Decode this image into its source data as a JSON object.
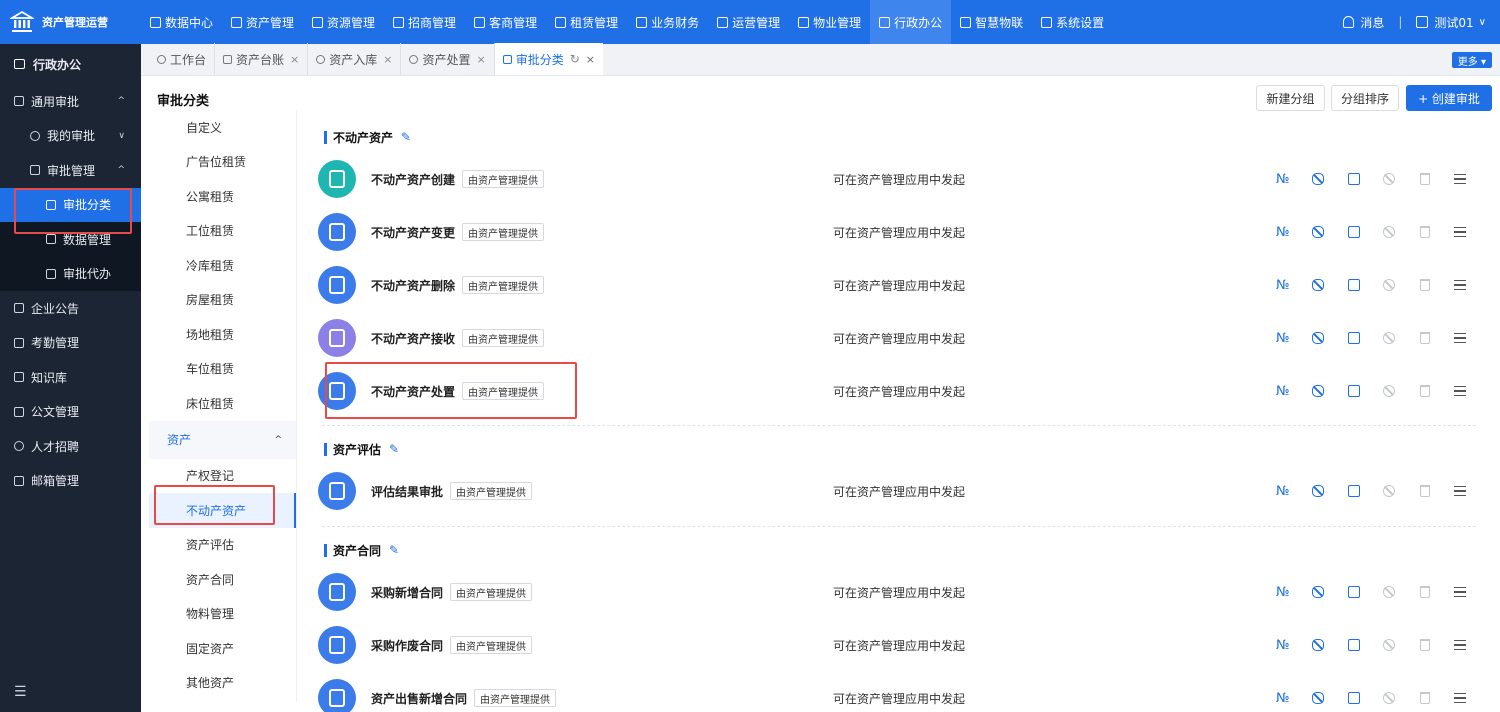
{
  "app": {
    "title": "资产管理运营"
  },
  "topnav": [
    {
      "label": "数据中心",
      "icon": "dashboard-icon"
    },
    {
      "label": "资产管理",
      "icon": "cube-icon"
    },
    {
      "label": "资源管理",
      "icon": "building-icon"
    },
    {
      "label": "招商管理",
      "icon": "tag-icon"
    },
    {
      "label": "客商管理",
      "icon": "users-icon"
    },
    {
      "label": "租赁管理",
      "icon": "home-icon"
    },
    {
      "label": "业务财务",
      "icon": "currency-icon"
    },
    {
      "label": "运营管理",
      "icon": "chart-icon"
    },
    {
      "label": "物业管理",
      "icon": "tools-icon"
    },
    {
      "label": "行政办公",
      "icon": "monitor-icon",
      "active": true
    },
    {
      "label": "智慧物联",
      "icon": "atom-icon"
    },
    {
      "label": "系统设置",
      "icon": "gear-icon"
    }
  ],
  "topright": {
    "messages": "消息",
    "separator": "|",
    "user": "测试01",
    "caret": "∨"
  },
  "sidebar": {
    "header": "行政办公",
    "items": [
      {
        "label": "通用审批",
        "arrow": "^"
      },
      {
        "label": "我的审批",
        "arrow": "∨"
      },
      {
        "label": "审批管理",
        "arrow": "^"
      },
      {
        "label": "审批分类"
      },
      {
        "label": "数据管理"
      },
      {
        "label": "审批代办"
      },
      {
        "label": "企业公告"
      },
      {
        "label": "考勤管理"
      },
      {
        "label": "知识库"
      },
      {
        "label": "公文管理"
      },
      {
        "label": "人才招聘"
      },
      {
        "label": "邮箱管理"
      }
    ],
    "collapse": "☰"
  },
  "tabs": [
    {
      "label": "工作台"
    },
    {
      "label": "资产台账",
      "close": "×"
    },
    {
      "label": "资产入库",
      "close": "×"
    },
    {
      "label": "资产处置",
      "close": "×"
    },
    {
      "label": "审批分类",
      "close": "×",
      "reload": "↻"
    }
  ],
  "more_button": "更多 ▾",
  "page": {
    "title": "审批分类",
    "buttons": {
      "new_group": "新建分组",
      "group_sort": "分组排序",
      "create": "+ 创建审批"
    }
  },
  "categories": {
    "items_top": [
      "自定义",
      "广告位租赁",
      "公寓租赁",
      "工位租赁",
      "冷库租赁",
      "房屋租赁",
      "场地租赁",
      "车位租赁",
      "床位租赁"
    ],
    "group": {
      "label": "资产",
      "arrow": "^"
    },
    "items_group": [
      "产权登记",
      "不动产资产",
      "资产评估",
      "资产合同",
      "物料管理",
      "固定资产",
      "其他资产"
    ]
  },
  "sections": [
    {
      "title": "不动产资产",
      "rows": [
        {
          "name": "不动产资产创建",
          "badge": "由资产管理提供",
          "desc": "可在资产管理应用中发起",
          "color": "#1fb5b0"
        },
        {
          "name": "不动产资产变更",
          "badge": "由资产管理提供",
          "desc": "可在资产管理应用中发起",
          "color": "#3b7bea"
        },
        {
          "name": "不动产资产删除",
          "badge": "由资产管理提供",
          "desc": "可在资产管理应用中发起",
          "color": "#3b7bea"
        },
        {
          "name": "不动产资产接收",
          "badge": "由资产管理提供",
          "desc": "可在资产管理应用中发起",
          "color": "#8b80e6"
        },
        {
          "name": "不动产资产处置",
          "badge": "由资产管理提供",
          "desc": "可在资产管理应用中发起",
          "color": "#3b7bea"
        }
      ]
    },
    {
      "title": "资产评估",
      "rows": [
        {
          "name": "评估结果审批",
          "badge": "由资产管理提供",
          "desc": "可在资产管理应用中发起",
          "color": "#3b7bea"
        }
      ]
    },
    {
      "title": "资产合同",
      "rows": [
        {
          "name": "采购新增合同",
          "badge": "由资产管理提供",
          "desc": "可在资产管理应用中发起",
          "color": "#3b7bea"
        },
        {
          "name": "采购作废合同",
          "badge": "由资产管理提供",
          "desc": "可在资产管理应用中发起",
          "color": "#3b7bea"
        },
        {
          "name": "资产出售新增合同",
          "badge": "由资产管理提供",
          "desc": "可在资产管理应用中发起",
          "color": "#3b7bea"
        }
      ]
    }
  ],
  "row_actions": {
    "number": "№"
  },
  "colors": {
    "primary": "#1f6fe6",
    "sidebar": "#1b2533",
    "highlight": "#e84a4a"
  }
}
